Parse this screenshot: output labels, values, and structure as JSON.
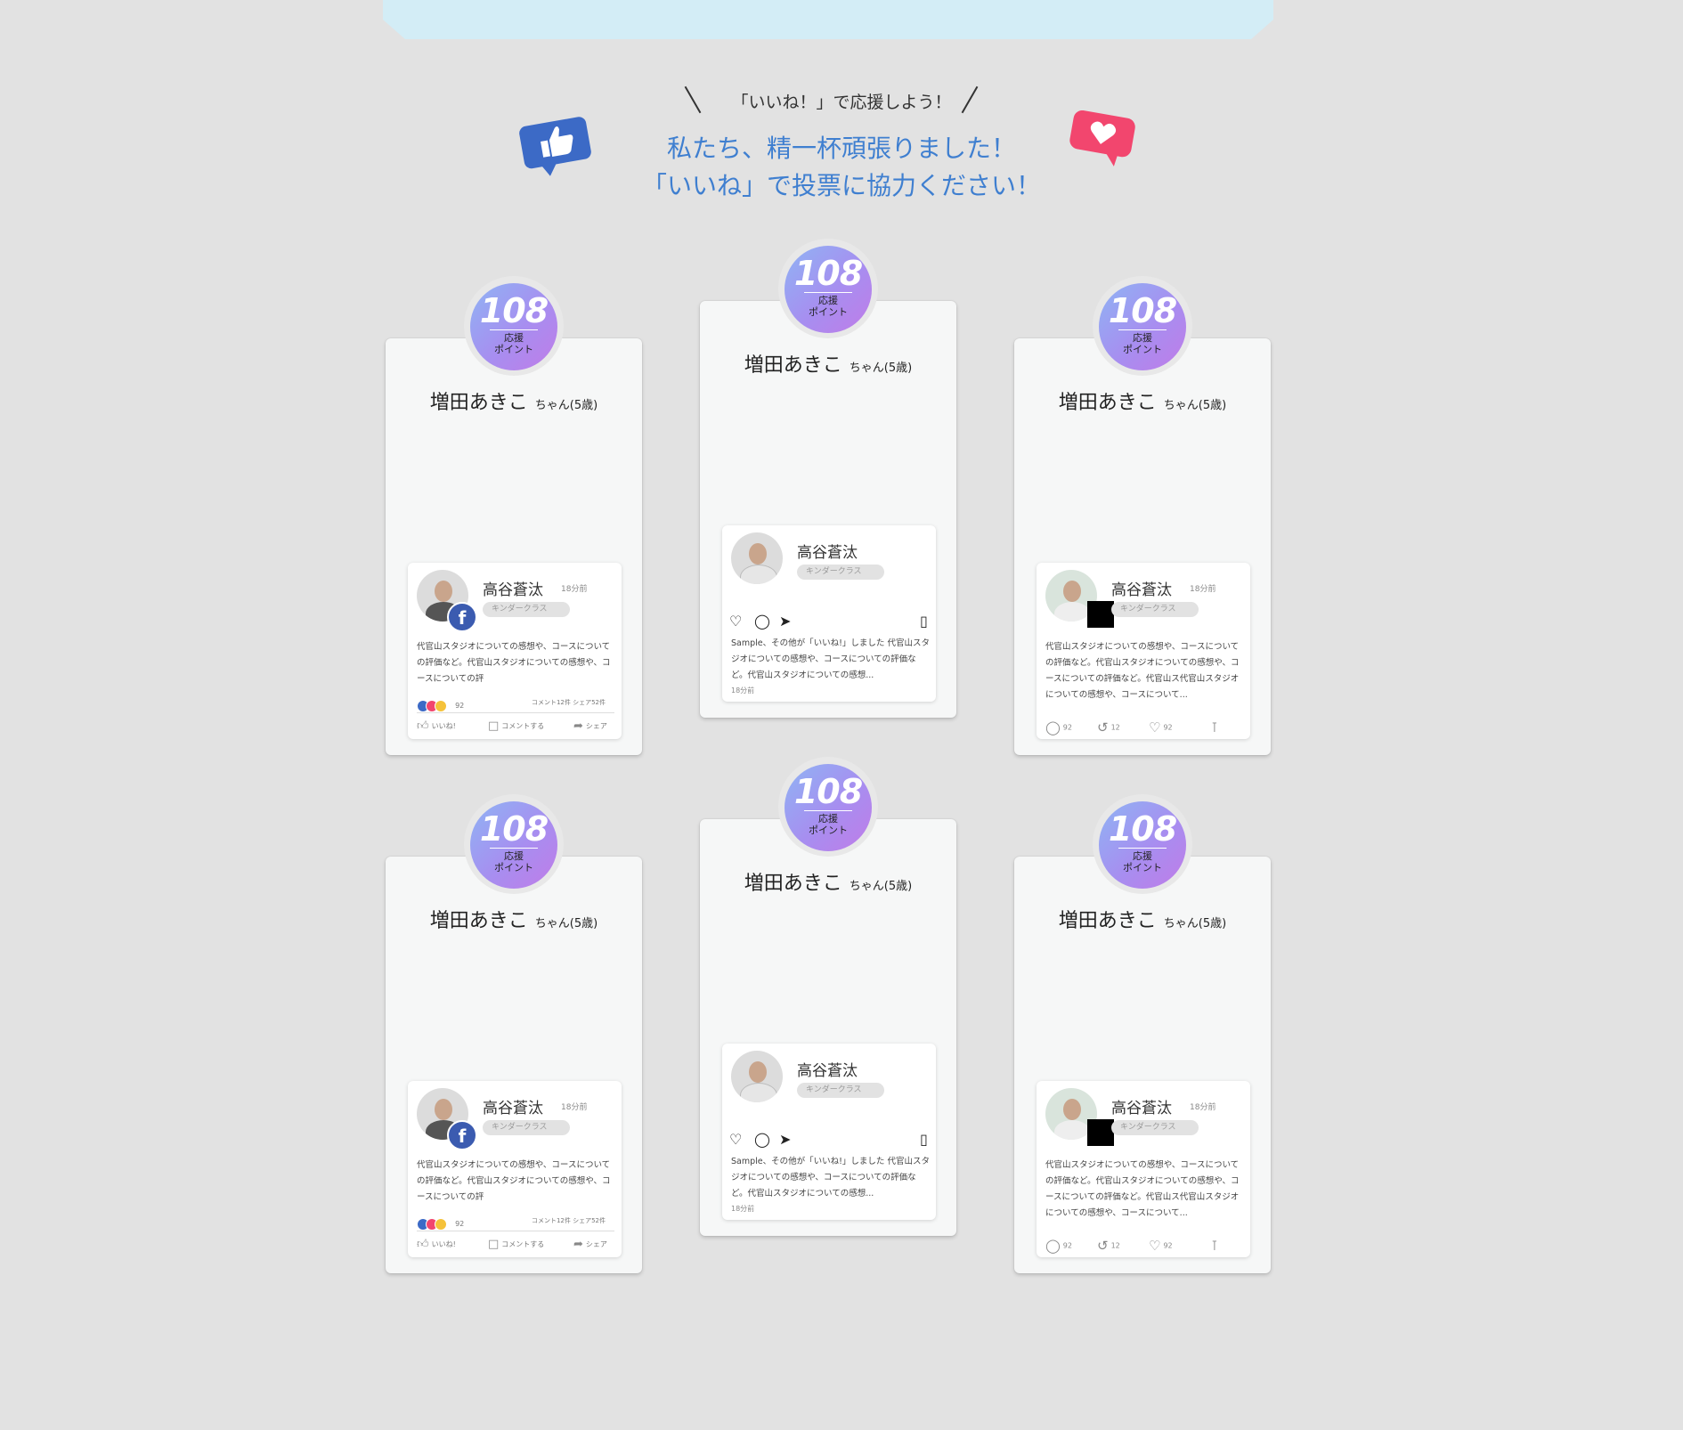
{
  "header": {
    "sub_heading": "「いいね！」で応援しよう！",
    "main_heading_line1": "私たち、精一杯頑張りました！",
    "main_heading_line2": "「いいね」で投票に協力ください！"
  },
  "colors": {
    "accent_blue": "#3f7fd0",
    "like_blue": "#3c6ac6",
    "heart_pink": "#f2466e",
    "badge_start": "#8fb4f4",
    "badge_end": "#c07ce8"
  },
  "badge": {
    "points": "108",
    "label_line1": "応援",
    "label_line2": "ポイント"
  },
  "child": {
    "name": "増田あきこ",
    "suffix": "ちゃん(5歳)"
  },
  "post_common": {
    "author": "高谷蒼汰",
    "time": "18分前",
    "class_pill": "キンダークラス"
  },
  "facebook_post": {
    "text": "代官山スタジオについての感想や、コースについての評価など。代官山スタジオについての感想や、コースについての評",
    "reaction_count": "92",
    "comment_share": "コメント12件 シェア52件",
    "actions": {
      "like": "いいね!",
      "comment": "コメントする",
      "share": "シェア"
    }
  },
  "instagram_post": {
    "text": "Sample、その他が「いいね!」しました 代官山スタジオについての感想や、コースについての評価など。代官山スタジオについての感想...",
    "time": "18分前"
  },
  "twitter_post": {
    "text": "代官山スタジオについての感想や、コースについての評価など。代官山スタジオについての感想や、コースについての評価など。代官山ス代官山スタジオについての感想や、コースについて...",
    "reply_count": "92",
    "retweet_count": "12",
    "like_count": "92"
  }
}
